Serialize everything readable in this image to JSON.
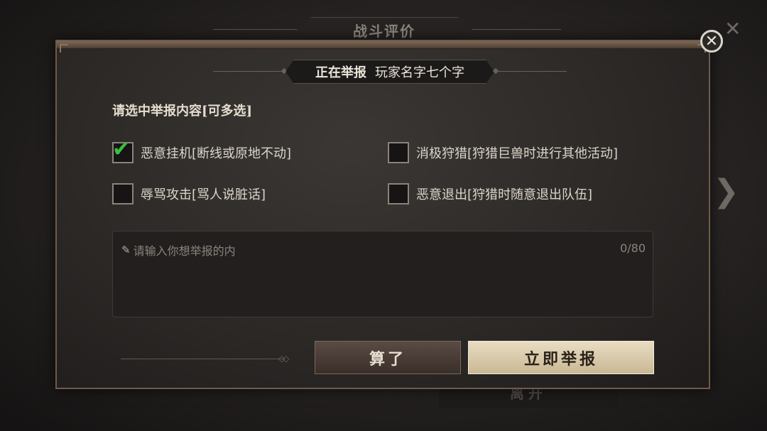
{
  "background": {
    "title": "战斗评价",
    "leave_button": "离开"
  },
  "dialog": {
    "header_label": "正在举报",
    "player_name": "玩家名字七个字",
    "section_title": "请选中举报内容[可多选]",
    "options": [
      {
        "label": "恶意挂机[断线或原地不动]",
        "checked": true
      },
      {
        "label": "消极狩猎[狩猎巨兽时进行其他活动]",
        "checked": false
      },
      {
        "label": "辱骂攻击[骂人说脏话]",
        "checked": false
      },
      {
        "label": "恶意退出[狩猎时随意退出队伍]",
        "checked": false
      }
    ],
    "input": {
      "placeholder": "请输入你想举报的内",
      "counter": "0/80"
    },
    "buttons": {
      "cancel": "算了",
      "submit": "立即举报"
    }
  },
  "icons": {
    "close": "close-icon",
    "next": "chevron-right-icon",
    "check": "checkmark-icon",
    "pencil": "pencil-icon"
  },
  "colors": {
    "check_green": "#38c13d",
    "submit_bg": "#e2d5b9",
    "cancel_bg": "#4a3d36"
  }
}
